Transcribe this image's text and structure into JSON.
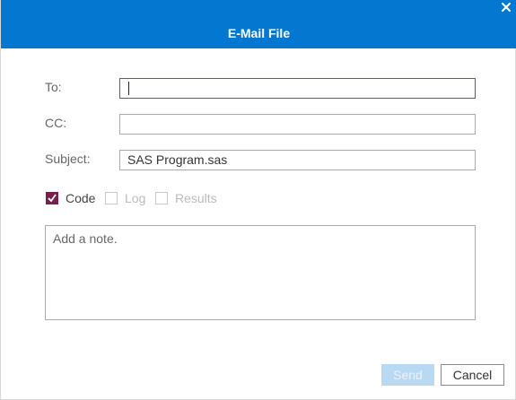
{
  "dialog": {
    "title": "E-Mail File",
    "close_icon": "close-icon"
  },
  "form": {
    "to_label": "To:",
    "to_value": "",
    "cc_label": "CC:",
    "cc_value": "",
    "subject_label": "Subject:",
    "subject_value": "SAS Program.sas"
  },
  "attachments": {
    "code": {
      "label": "Code",
      "checked": true,
      "enabled": true
    },
    "log": {
      "label": "Log",
      "checked": false,
      "enabled": false
    },
    "results": {
      "label": "Results",
      "checked": false,
      "enabled": false
    }
  },
  "note": {
    "placeholder": "Add a note."
  },
  "buttons": {
    "send": "Send",
    "cancel": "Cancel",
    "send_enabled": false
  },
  "colors": {
    "titlebar": "#0478d1",
    "checkbox_checked": "#7a1f4b",
    "send_disabled": "#b9d8f2"
  }
}
